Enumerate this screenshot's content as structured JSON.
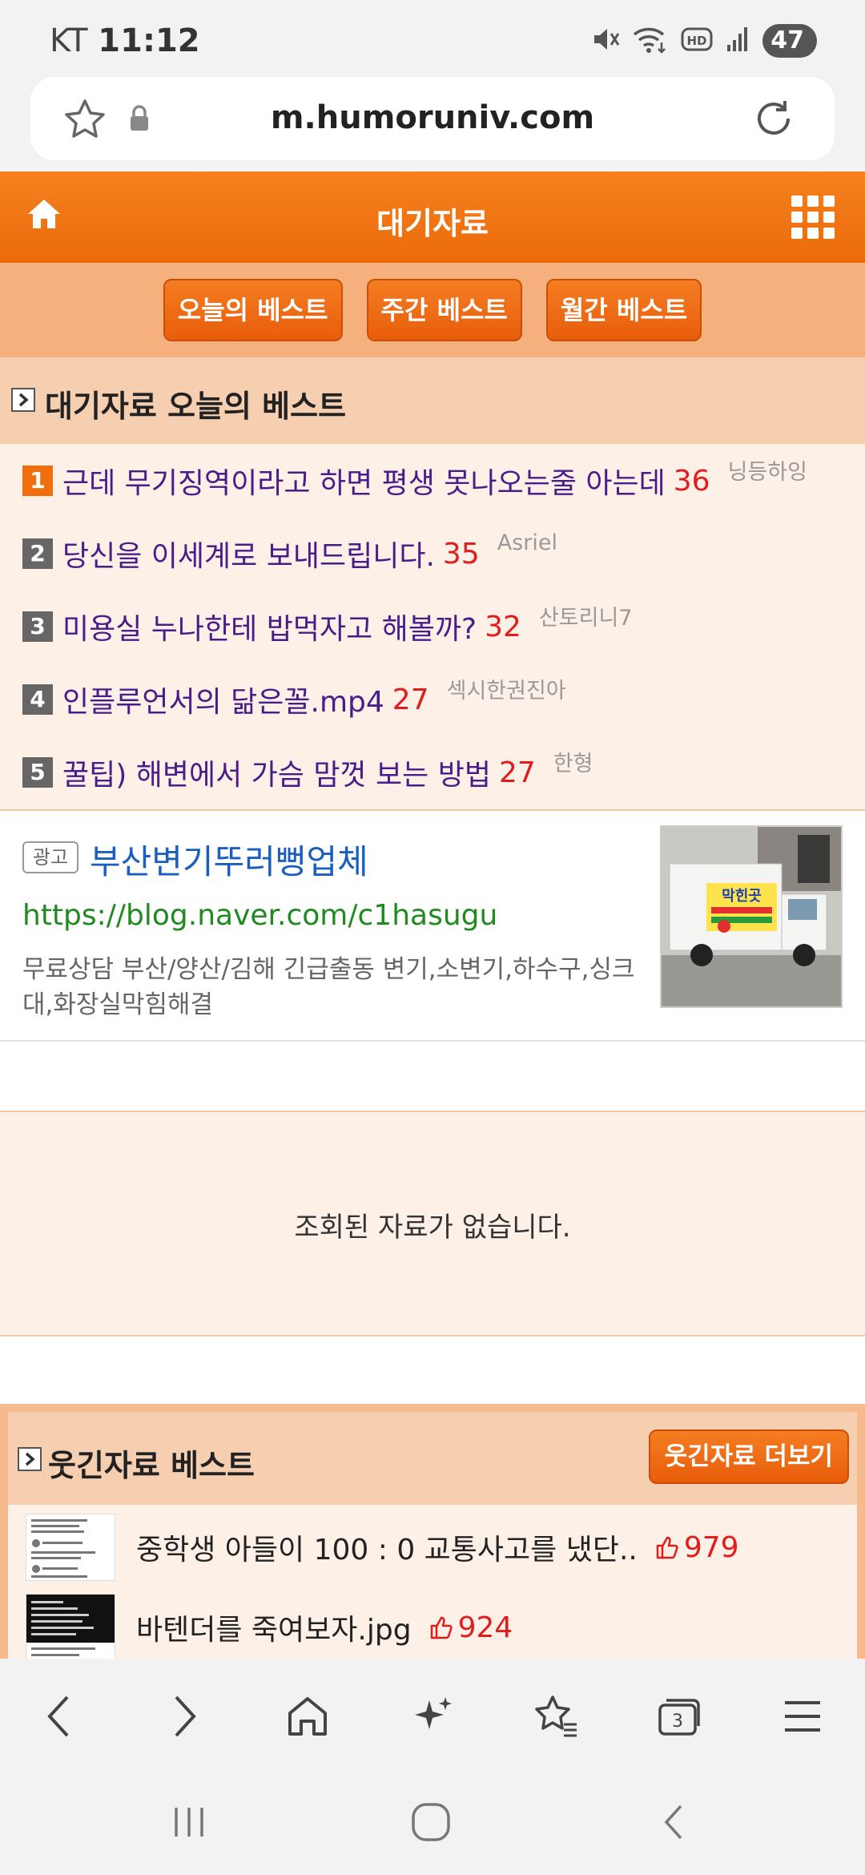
{
  "status_bar": {
    "carrier": "KT",
    "time": "11:12",
    "battery": "47",
    "icons": [
      "mute-icon",
      "wifi-icon",
      "hd-icon",
      "signal-icon"
    ]
  },
  "browser": {
    "url": "m.humoruniv.com"
  },
  "header": {
    "title": "대기자료"
  },
  "tabs": [
    {
      "label": "오늘의 베스트"
    },
    {
      "label": "주간 베스트"
    },
    {
      "label": "월간 베스트"
    }
  ],
  "best_section": {
    "title": "대기자료 오늘의 베스트",
    "items": [
      {
        "rank": "1",
        "title": "근데 무기징역이라고 하면 평생 못나오는줄 아는데",
        "count": "36",
        "author": "닝등하잉"
      },
      {
        "rank": "2",
        "title": "당신을 이세계로 보내드립니다.",
        "count": "35",
        "author": "Asriel"
      },
      {
        "rank": "3",
        "title": "미용실 누나한테 밥먹자고 해볼까?",
        "count": "32",
        "author": "산토리니7"
      },
      {
        "rank": "4",
        "title": "인플루언서의 닮은꼴.mp4",
        "count": "27",
        "author": "섹시한권진아"
      },
      {
        "rank": "5",
        "title": "꿀팁) 해변에서 가슴 맘껏 보는 방법",
        "count": "27",
        "author": "한형"
      }
    ]
  },
  "ad": {
    "badge": "광고",
    "title": "부산변기뚜러뻥업체",
    "url": "https://blog.naver.com/c1hasugu",
    "description": "무료상담 부산/양산/김해 긴급출동 변기,소변기,하수구,싱크대,화장실막힘해결",
    "truck_sign": "막힌곳"
  },
  "empty_message": "조회된 자료가 없습니다.",
  "humor_section": {
    "title": "웃긴자료 베스트",
    "more_label": "웃긴자료 더보기",
    "items": [
      {
        "title": "중학생 아들이 100 : 0 교통사고를 냈단..",
        "likes": "979"
      },
      {
        "title": "바텐더를 죽여보자.jpg",
        "likes": "924"
      }
    ]
  },
  "browser_toolbar": {
    "tab_count": "3"
  },
  "colors": {
    "accent": "#f06e0c",
    "header_bg": "#f7811f",
    "tabs_bg": "#f6b07d",
    "list_bg": "#fdf0e6",
    "count_red": "#e31b1b",
    "title_purple": "#4a1c8a"
  }
}
